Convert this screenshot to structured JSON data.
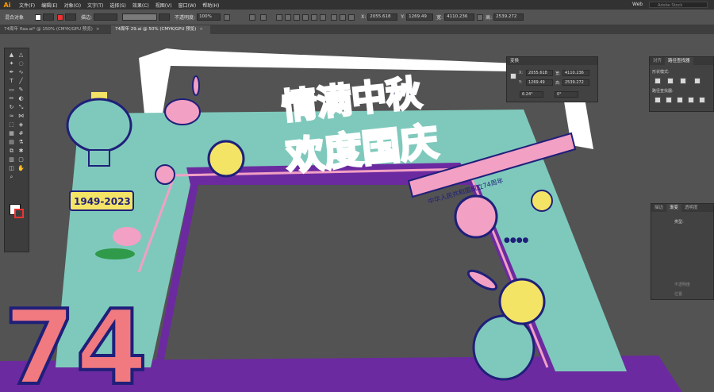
{
  "app": {
    "logo": "Ai"
  },
  "menu": [
    "文件(F)",
    "编辑(E)",
    "对象(O)",
    "文字(T)",
    "选择(S)",
    "效果(C)",
    "视图(V)",
    "窗口(W)",
    "帮助(H)"
  ],
  "workspace": {
    "label": "Web",
    "search_placeholder": "Adobe Stock"
  },
  "control_bar": {
    "selection_label": "混合对象",
    "stroke_label": "描边:",
    "opacity_label": "不透明度:",
    "opacity_value": "100%",
    "x_label": "X:",
    "x_value": "2055.618",
    "y_label": "Y:",
    "y_value": "1269.49",
    "w_label": "宽:",
    "w_value": "4110.236",
    "h_label": "高:",
    "h_value": "2539.272"
  },
  "tabs": [
    {
      "label": "74周年 flaa.ai* @ 150% (CMYK/GPU 预览)",
      "close": "×"
    },
    {
      "label": "74周年 29.ai @ 50% (CMYK/GPU 预览)",
      "close": "×"
    }
  ],
  "transform_panel": {
    "title": "变换",
    "x_label": "X:",
    "x_value": "2055.618",
    "w_label": "宽:",
    "w_value": "4110.236",
    "y_label": "Y:",
    "y_value": "1269.49",
    "h_label": "高:",
    "h_value": "2539.272",
    "angle_value": "6.24°",
    "shear_value": "0°"
  },
  "pathfinder_panel": {
    "tab_align": "对齐",
    "tab_pathfinder": "路径查找器",
    "shape_modes": "形状模式:",
    "pathfinders": "路径查找器:"
  },
  "gradient_panel": {
    "tab_stroke": "描边",
    "tab_gradient": "渐变",
    "tab_transparency": "透明度",
    "type_label": "类型:",
    "opacity_label": "不透明度",
    "location_label": "位置"
  },
  "artwork": {
    "headline_line1": "情满中秋",
    "headline_line2": "欢度国庆",
    "year_number": "74",
    "date_badge": "1949-2023",
    "ribbon_text": "中华人民共和国成立74周年",
    "dots_text": "●●●●",
    "colors": {
      "teal": "#7fc9bc",
      "navy": "#1f1f7a",
      "pink": "#f2a0c4",
      "coral": "#f07a80",
      "yellow": "#f4e466",
      "purple": "#6c2aa0",
      "white": "#ffffff",
      "canvas": "#535353"
    }
  },
  "icons": [
    "selection-icon",
    "direct-selection-icon",
    "magic-wand-icon",
    "lasso-icon",
    "pen-icon",
    "curvature-icon",
    "type-icon",
    "line-icon",
    "rectangle-icon",
    "brush-icon",
    "pencil-icon",
    "eraser-icon",
    "rotate-icon",
    "scale-icon",
    "warp-icon",
    "width-icon",
    "free-transform-icon",
    "shape-builder-icon",
    "perspective-icon",
    "mesh-icon",
    "gradient-icon",
    "eyedropper-icon",
    "blend-icon",
    "symbol-icon",
    "graph-icon",
    "artboard-icon",
    "slice-icon",
    "hand-icon",
    "zoom-icon"
  ]
}
